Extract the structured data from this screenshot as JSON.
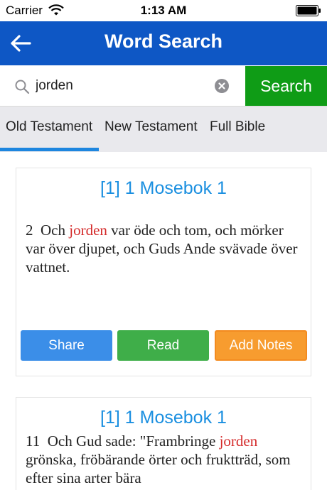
{
  "status_bar": {
    "carrier": "Carrier",
    "time": "1:13 AM"
  },
  "nav": {
    "title": "Word Search"
  },
  "search": {
    "value": "jorden",
    "button_label": "Search"
  },
  "tabs": [
    {
      "label": "Old Testament",
      "selected": true
    },
    {
      "label": "New Testament",
      "selected": false
    },
    {
      "label": "Full Bible",
      "selected": false
    }
  ],
  "results": [
    {
      "reference": "[1] 1 Mosebok  1",
      "verse_number": "2",
      "text_before": "Och",
      "highlight": "jorden",
      "text_after": "var öde och tom, och mörker var över djupet, och Guds Ande svävade över vattnet.",
      "buttons": {
        "share": "Share",
        "read": "Read",
        "notes": "Add Notes"
      }
    },
    {
      "reference": "[1] 1 Mosebok  1",
      "verse_number": "11",
      "text_before": "Och Gud sade: \"Frambringe",
      "highlight": "jorden",
      "text_after": "grönska, fröbärande örter och fruktträd, som efter sina arter bära"
    }
  ],
  "colors": {
    "nav_bg": "#0e57c5",
    "search_btn": "#0f9c16",
    "accent": "#1a8fe0",
    "highlight": "#d42a2a"
  }
}
